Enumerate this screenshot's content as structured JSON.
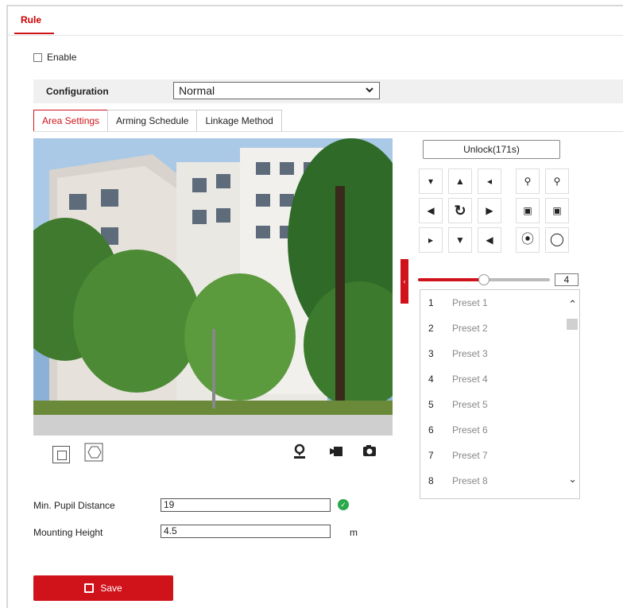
{
  "header": {
    "tab_label": "Rule"
  },
  "enable": {
    "label": "Enable",
    "checked": false
  },
  "configuration": {
    "label": "Configuration",
    "value": "Normal"
  },
  "subtabs": [
    "Area Settings",
    "Arming Schedule",
    "Linkage Method"
  ],
  "ptz": {
    "unlock_label": "Unlock(171s)",
    "speed": "4",
    "speed_fraction": 0.5
  },
  "presets": [
    {
      "num": "1",
      "name": "Preset 1"
    },
    {
      "num": "2",
      "name": "Preset 2"
    },
    {
      "num": "3",
      "name": "Preset 3"
    },
    {
      "num": "4",
      "name": "Preset 4"
    },
    {
      "num": "5",
      "name": "Preset 5"
    },
    {
      "num": "6",
      "name": "Preset 6"
    },
    {
      "num": "7",
      "name": "Preset 7"
    },
    {
      "num": "8",
      "name": "Preset 8"
    }
  ],
  "form": {
    "pupil_label": "Min. Pupil Distance",
    "pupil_value": "19",
    "height_label": "Mounting Height",
    "height_value": "4.5",
    "height_unit": "m"
  },
  "save_label": "Save",
  "colors": {
    "accent": "#d0131b",
    "ok": "#2aa84a"
  }
}
